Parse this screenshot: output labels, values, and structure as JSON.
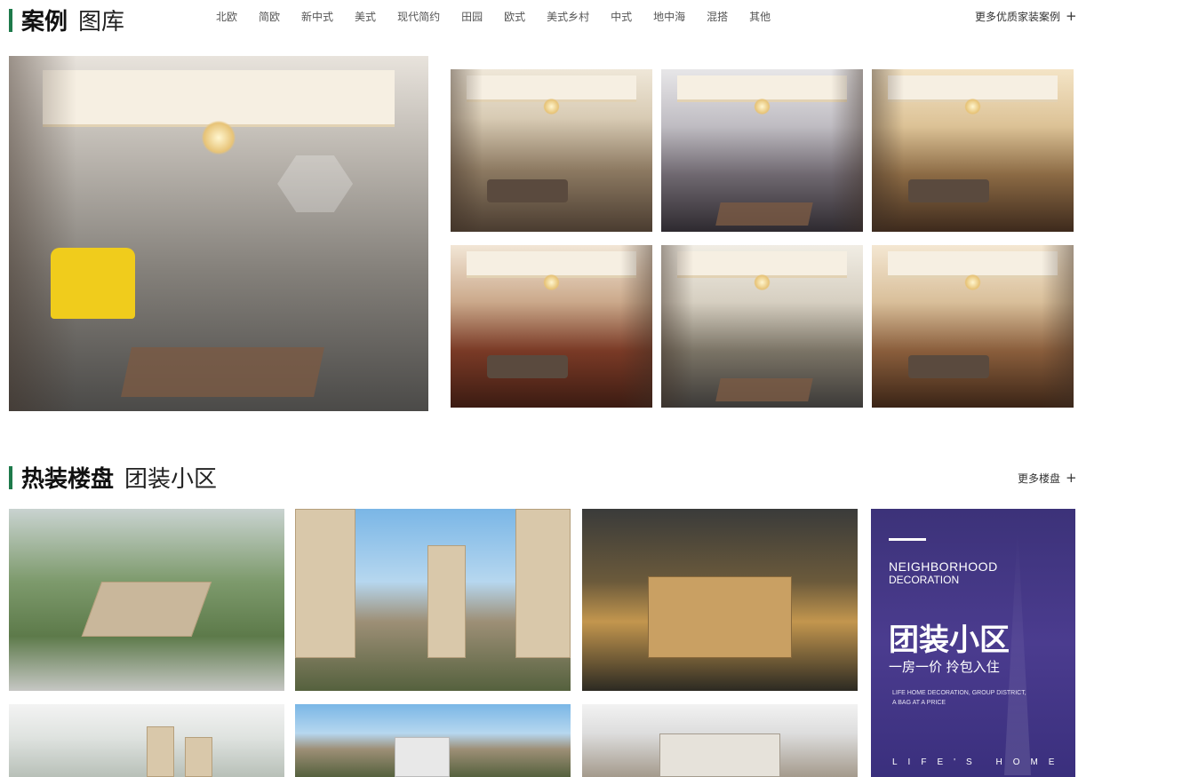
{
  "cases_section": {
    "title_strong": "案例",
    "title_light": "图库",
    "categories": [
      "北欧",
      "简欧",
      "新中式",
      "美式",
      "现代简约",
      "田园",
      "欧式",
      "美式乡村",
      "中式",
      "地中海",
      "混搭",
      "其他"
    ],
    "more_label": "更多优质家装案例",
    "accent_color": "#1e7a4b"
  },
  "community_section": {
    "title_strong": "热装楼盘",
    "title_light": "团装小区",
    "more_label": "更多楼盘",
    "promo": {
      "en_line1": "NEIGHBORHOOD",
      "en_line2": "DECORATION",
      "cn_title": "团装小区",
      "cn_subtitle": "一房一价 拎包入住",
      "small_line1": "LIFE HOME DECORATION, GROUP DISTRICT,",
      "small_line2": "A BAG AT A PRICE",
      "footer": "LIFE'S HOME",
      "bg_color": "#3c3279"
    }
  },
  "icons": {
    "more": "plus-icon"
  }
}
